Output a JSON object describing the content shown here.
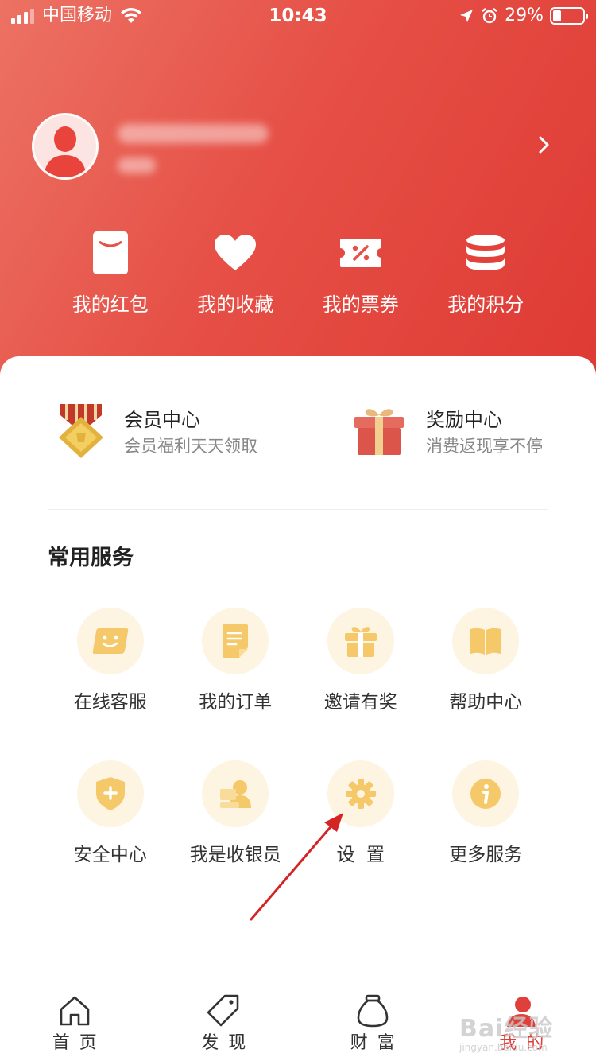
{
  "status_bar": {
    "carrier": "中国移动",
    "time": "10:43",
    "battery_percent": "29%",
    "battery_level": 0.29
  },
  "quick_actions": [
    {
      "label": "我的红包",
      "icon": "red-envelope-icon"
    },
    {
      "label": "我的收藏",
      "icon": "heart-icon"
    },
    {
      "label": "我的票券",
      "icon": "coupon-icon"
    },
    {
      "label": "我的积分",
      "icon": "coins-icon"
    }
  ],
  "centers": [
    {
      "title": "会员中心",
      "subtitle": "会员福利天天领取",
      "icon": "medal-icon"
    },
    {
      "title": "奖励中心",
      "subtitle": "消费返现享不停",
      "icon": "gift-box-icon"
    }
  ],
  "services_title": "常用服务",
  "services": [
    {
      "label": "在线客服",
      "icon": "chat-face-icon"
    },
    {
      "label": "我的订单",
      "icon": "order-doc-icon"
    },
    {
      "label": "邀请有奖",
      "icon": "gift-icon"
    },
    {
      "label": "帮助中心",
      "icon": "book-icon"
    },
    {
      "label": "安全中心",
      "icon": "shield-plus-icon"
    },
    {
      "label": "我是收银员",
      "icon": "cashier-icon"
    },
    {
      "label": "设  置",
      "icon": "gear-icon"
    },
    {
      "label": "更多服务",
      "icon": "info-icon"
    }
  ],
  "tabs": [
    {
      "label": "首页",
      "icon": "home-icon",
      "active": false
    },
    {
      "label": "发现",
      "icon": "tag-icon",
      "active": false
    },
    {
      "label": "财富",
      "icon": "money-bag-icon",
      "active": false
    },
    {
      "label": "我的",
      "icon": "user-icon",
      "active": true
    }
  ],
  "watermark": {
    "main": "Bai经验",
    "sub": "jingyan.baidu.com"
  },
  "colors": {
    "brand_red": "#e0403a",
    "service_circle": "#fdf4e1",
    "service_icon": "#f5c96a"
  }
}
